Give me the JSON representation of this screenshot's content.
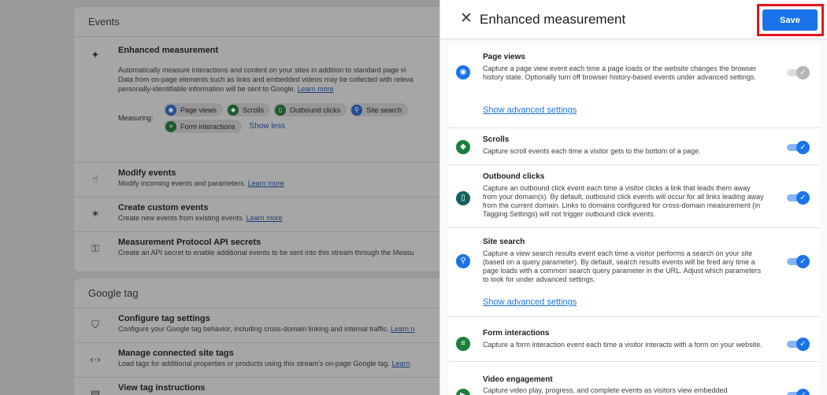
{
  "background": {
    "events_card": {
      "title": "Events",
      "enhanced": {
        "title": "Enhanced measurement",
        "desc1": "Automatically measure interactions and content on your sites in addition to standard page vi",
        "desc2": "Data from on-page elements such as links and embedded videos may be collected with releva",
        "desc3": "personally-identifiable information will be sent to Google.",
        "learn_more": "Learn more",
        "measuring_label": "Measuring:",
        "chips": [
          "Page views",
          "Scrolls",
          "Outbound clicks",
          "Site search",
          "Form interactions"
        ],
        "show_less": "Show less"
      },
      "modify": {
        "title": "Modify events",
        "desc": "Modify incoming events and parameters.",
        "learn_more": "Learn more"
      },
      "custom": {
        "title": "Create custom events",
        "desc": "Create new events from existing events.",
        "learn_more": "Learn more"
      },
      "mp": {
        "title": "Measurement Protocol API secrets",
        "desc": "Create an API secret to enable additional events to be sent into this stream through the Measu"
      }
    },
    "gtag_card": {
      "title": "Google tag",
      "configure": {
        "title": "Configure tag settings",
        "desc": "Configure your Google tag behavior, including cross-domain linking and internal traffic.",
        "learn_more": "Learn n"
      },
      "manage": {
        "title": "Manage connected site tags",
        "desc": "Load tags for additional properties or products using this stream's on-page Google tag.",
        "learn_more": "Learn"
      },
      "view": {
        "title": "View tag instructions"
      }
    }
  },
  "panel": {
    "title": "Enhanced measurement",
    "save_label": "Save",
    "items": [
      {
        "title": "Page views",
        "desc": "Capture a page view event each time a page loads or the website changes the browser history state. Optionally turn off browser history-based events under advanced settings.",
        "advanced": "Show advanced settings",
        "enabled": true
      },
      {
        "title": "Scrolls",
        "desc": "Capture scroll events each time a visitor gets to the bottom of a page.",
        "enabled": true
      },
      {
        "title": "Outbound clicks",
        "desc": "Capture an outbound click event each time a visitor clicks a link that leads them away from your domain(s). By default, outbound click events will occur for all links leading away from the current domain. Links to domains configured for cross-domain measurement (in Tagging Settings) will not trigger outbound click events.",
        "enabled": true
      },
      {
        "title": "Site search",
        "desc": "Capture a view search results event each time a visitor performs a search on your site (based on a query parameter). By default, search results events will be fired any time a page loads with a common search query parameter in the URL. Adjust which parameters to look for under advanced settings.",
        "advanced": "Show advanced settings",
        "enabled": true
      },
      {
        "title": "Form interactions",
        "desc": "Capture a form interaction event each time a visitor interacts with a form on your website.",
        "enabled": true
      },
      {
        "title": "Video engagement",
        "desc": "Capture video play, progress, and complete events as visitors view embedded",
        "enabled": true
      }
    ]
  },
  "colors": {
    "accent": "#1a73e8",
    "highlight": "#e8141a",
    "green": "#188038"
  },
  "icons": {
    "close": "close-icon",
    "sparkle": "sparkle-icon",
    "eye": "eye-icon",
    "scroll": "scroll-icon",
    "mouse": "mouse-icon",
    "search": "search-icon",
    "form": "form-icon",
    "video": "video-icon"
  }
}
